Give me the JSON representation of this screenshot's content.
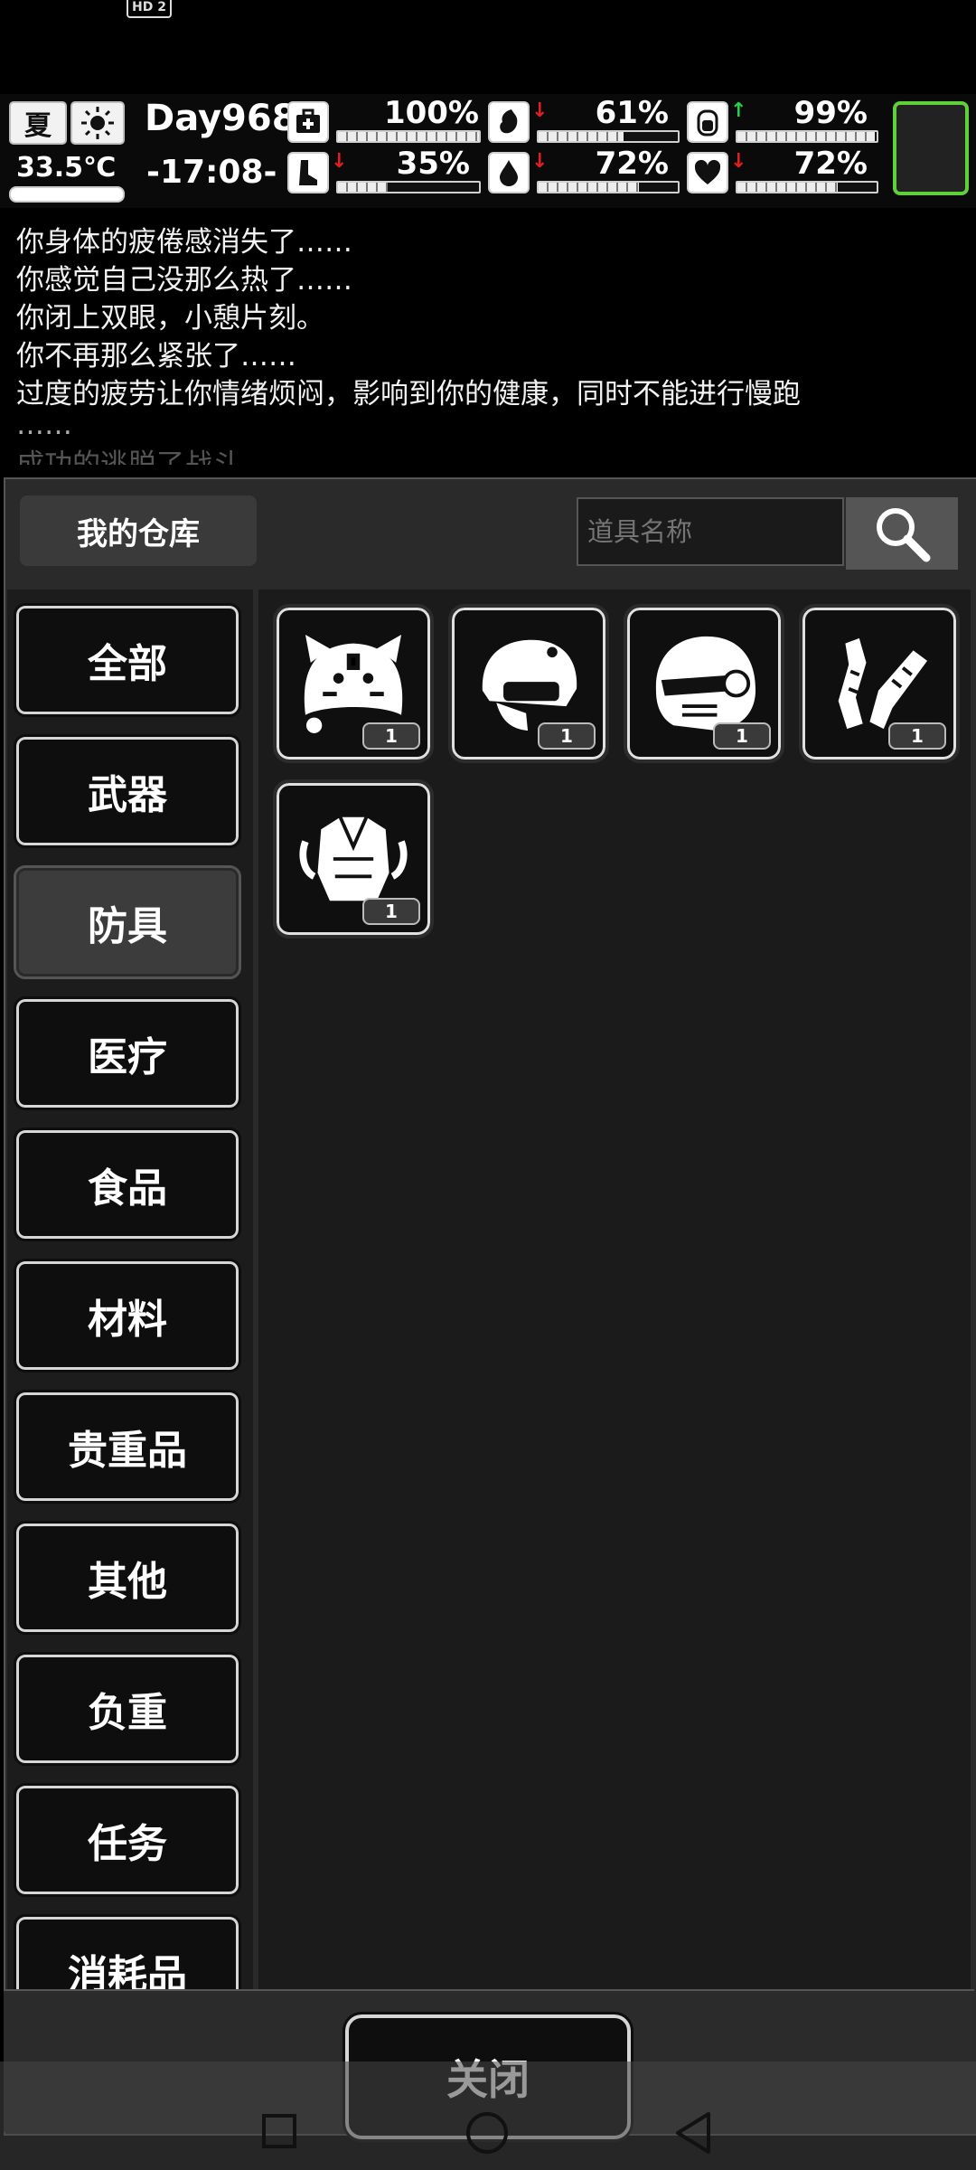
{
  "status_bar": {
    "network_badge": "HD 2"
  },
  "hud": {
    "season": "夏",
    "weather_icon": "sun-icon",
    "temperature": "33.5℃",
    "day": "Day968",
    "time": "-17:08-",
    "stats": [
      {
        "icon": "medkit-icon",
        "value": "100%",
        "fraction": 1.0,
        "trend": ""
      },
      {
        "icon": "stomach-icon",
        "value": "61%",
        "fraction": 0.61,
        "trend": "down"
      },
      {
        "icon": "battery-icon",
        "value": "99%",
        "fraction": 0.99,
        "trend": "up"
      },
      {
        "icon": "foot-icon",
        "value": "35%",
        "fraction": 0.35,
        "trend": "down"
      },
      {
        "icon": "water-drop-icon",
        "value": "72%",
        "fraction": 0.72,
        "trend": "down"
      },
      {
        "icon": "heart-icon",
        "value": "72%",
        "fraction": 0.72,
        "trend": "down"
      }
    ]
  },
  "log": {
    "lines": [
      "你身体的疲倦感消失了……",
      "你感觉自己没那么热了……",
      "你闭上双眼，小憩片刻。",
      "你不再那么紧张了……",
      "过度的疲劳让你情绪烦闷，影响到你的健康，同时不能进行慢跑",
      "……",
      "成功的逃脱了战斗"
    ]
  },
  "warehouse": {
    "title": "我的仓库",
    "search_placeholder": "道具名称",
    "categories": [
      "全部",
      "武器",
      "防具",
      "医疗",
      "食品",
      "材料",
      "贵重品",
      "其他",
      "负重",
      "任务",
      "消耗品"
    ],
    "active_category": "防具",
    "items": [
      {
        "icon": "tiger-hat-icon",
        "qty": "1"
      },
      {
        "icon": "tactical-helmet-icon",
        "qty": "1"
      },
      {
        "icon": "full-helmet-icon",
        "qty": "1"
      },
      {
        "icon": "arm-guards-icon",
        "qty": "1"
      },
      {
        "icon": "armor-vest-icon",
        "qty": "1"
      }
    ],
    "close_label": "关闭"
  }
}
